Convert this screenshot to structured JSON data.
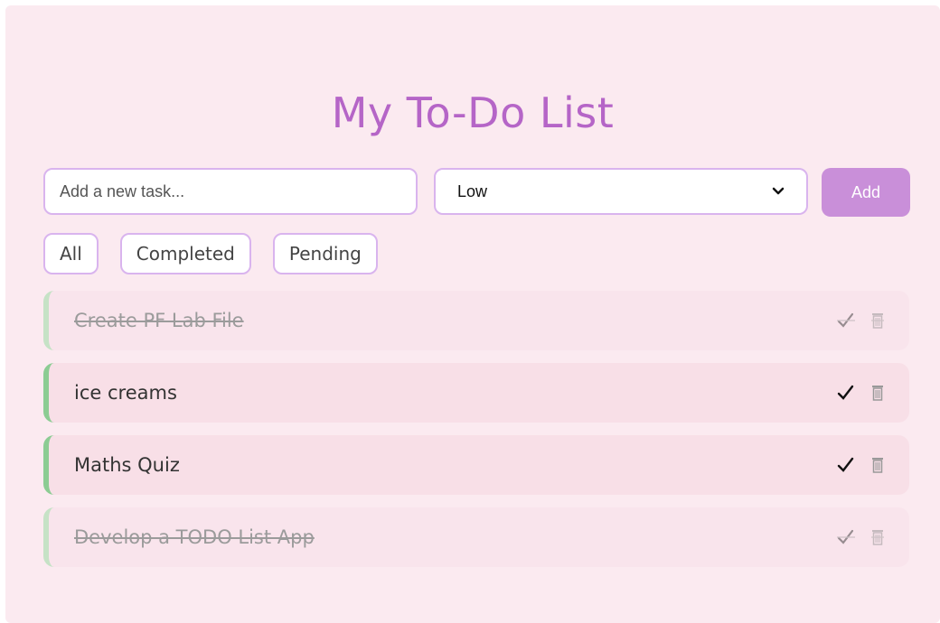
{
  "title": "My To-Do List",
  "input": {
    "placeholder": "Add a new task..."
  },
  "priority": {
    "selected": "Low"
  },
  "add_label": "Add",
  "filters": [
    "All",
    "Completed",
    "Pending"
  ],
  "tasks": [
    {
      "text": "Create PF Lab File",
      "completed": true
    },
    {
      "text": "ice creams",
      "completed": false
    },
    {
      "text": "Maths Quiz",
      "completed": false
    },
    {
      "text": "Develop a TODO List App",
      "completed": true
    }
  ],
  "icons": {
    "complete": "check-icon",
    "delete": "trash-icon",
    "dropdown": "chevron-down-icon"
  },
  "colors": {
    "accent": "#b565c7",
    "button": "#c98fd9",
    "border": "#d9b4ee",
    "background": "#fbeaf0",
    "task_bar": "#8ccc93"
  }
}
